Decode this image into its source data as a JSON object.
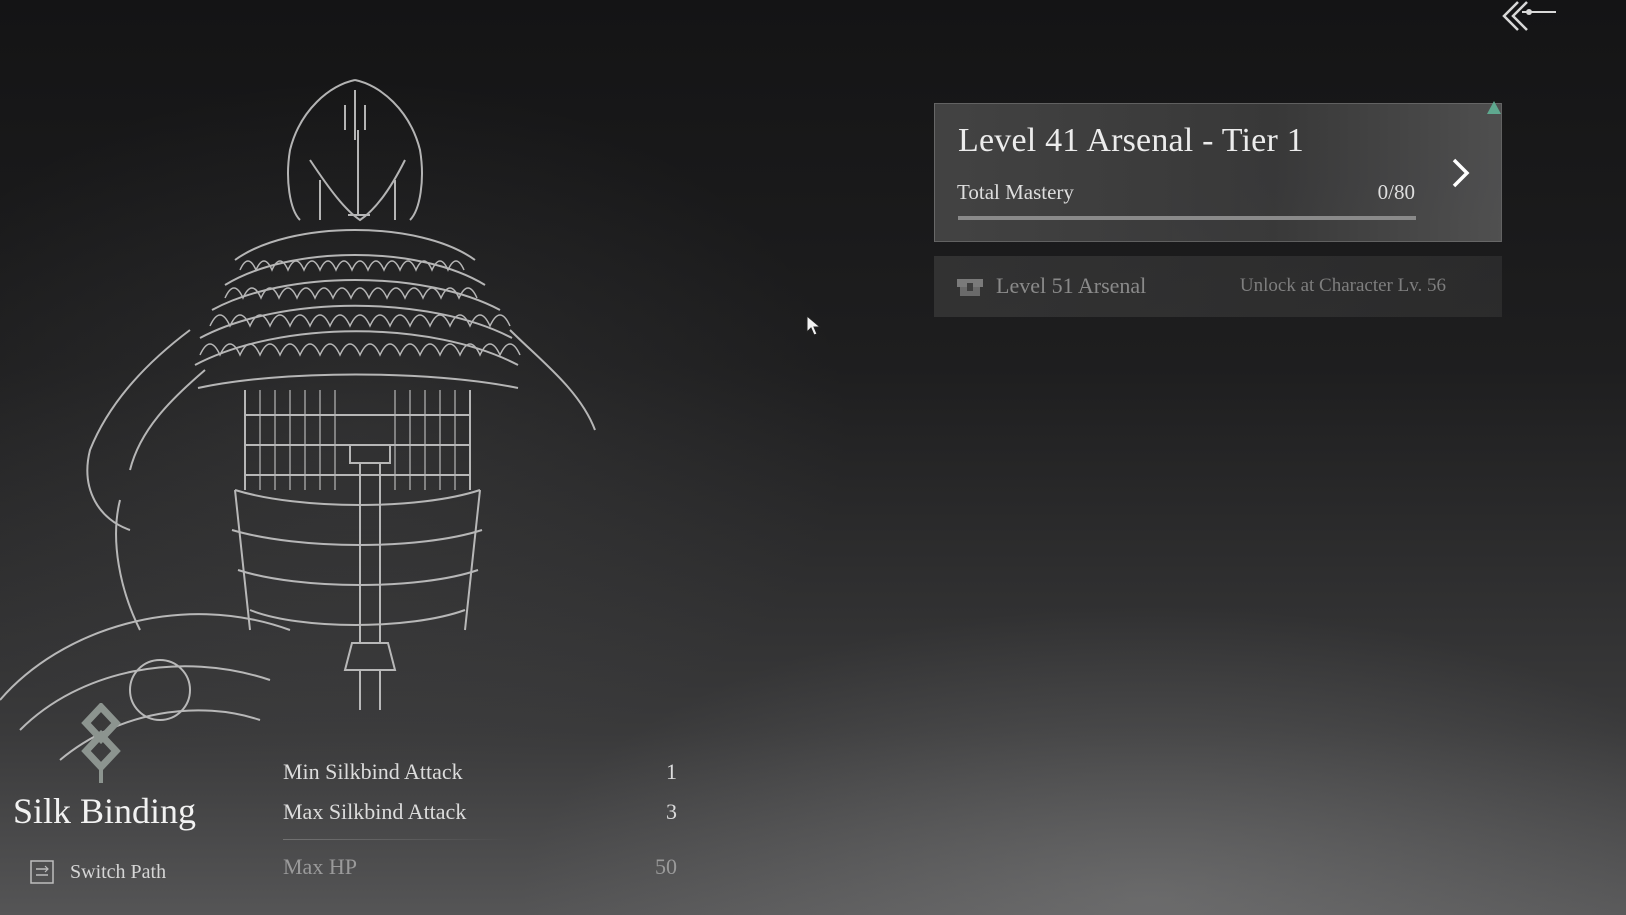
{
  "navigation": {
    "back_icon": "double-chevron-left-icon"
  },
  "arsenal": {
    "title": "Level 41 Arsenal - Tier 1",
    "mastery_label": "Total Mastery",
    "mastery_value": "0/80",
    "mastery_progress": 0,
    "arrow_icon": "chevron-right-icon",
    "marker_color": "#5fa88f"
  },
  "locked_arsenal": {
    "icon": "lock-chest-icon",
    "title": "Level 51 Arsenal",
    "requirement": "Unlock at Character Lv. 56"
  },
  "path": {
    "emblem_icon": "diamond-chain-emblem-icon",
    "name": "Silk Binding",
    "switch_icon": "switch-path-icon",
    "switch_label": "Switch Path"
  },
  "stats": [
    {
      "label": "Min Silkbind Attack",
      "value": "1"
    },
    {
      "label": "Max Silkbind Attack",
      "value": "3"
    },
    {
      "label": "Max HP",
      "value": "50"
    }
  ]
}
